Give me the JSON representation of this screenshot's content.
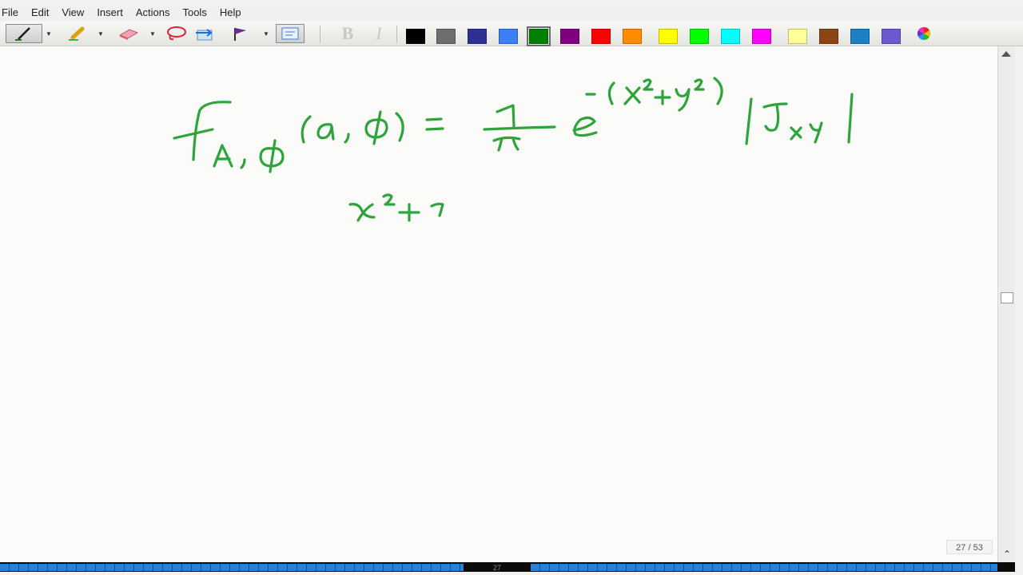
{
  "menu": {
    "items": [
      {
        "label": "File"
      },
      {
        "label": "Edit"
      },
      {
        "label": "View"
      },
      {
        "label": "Insert"
      },
      {
        "label": "Actions"
      },
      {
        "label": "Tools"
      },
      {
        "label": "Help"
      }
    ]
  },
  "toolbar": {
    "tools": [
      "pen-icon",
      "highlighter-icon",
      "eraser-icon",
      "lasso-select-icon",
      "insert-space-icon",
      "flag-icon",
      "text-box-icon"
    ],
    "bold_label": "B",
    "italic_label": "I",
    "pen_color_selected": "#008000",
    "palette": [
      "#000000",
      "#6e6e6e",
      "#2e3192",
      "#3b7ef6",
      "#008000",
      "#800080",
      "#ff0000",
      "#ff8c00",
      "#ffff00",
      "#00ff00",
      "#00ffff",
      "#ff00ff",
      "#ffff99",
      "#8b4513",
      "#1e7fc2",
      "#6a5acd"
    ],
    "custom_color_icon": "color-wheel-icon"
  },
  "page": {
    "ink_color": "#2ea43a",
    "page_indicator": "27 / 53"
  },
  "taskbar": {
    "center_label": "27"
  }
}
